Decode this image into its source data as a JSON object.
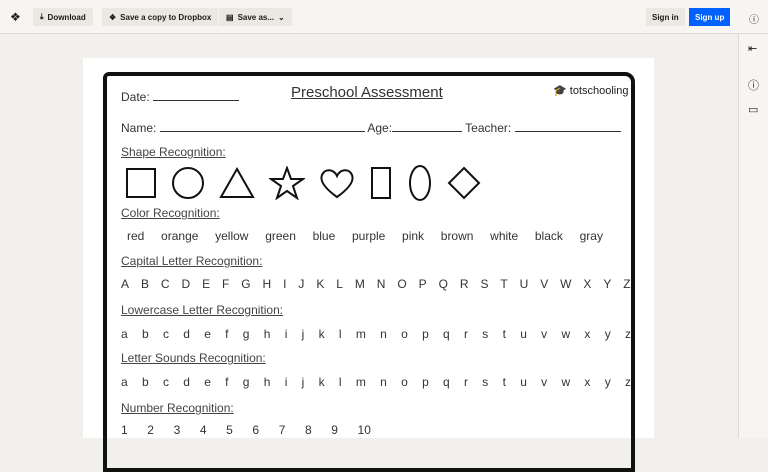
{
  "toolbar": {
    "download": "Download",
    "save_copy": "Save a copy to Dropbox",
    "save_as": "Save as...",
    "sign_in": "Sign in",
    "sign_up": "Sign up"
  },
  "doc": {
    "title": "Preschool Assessment",
    "brand": "totschooling",
    "date_label": "Date:",
    "name_label": "Name:",
    "age_label": "Age:",
    "teacher_label": "Teacher:",
    "shape_heading": "Shape Recognition:",
    "color_heading": "Color Recognition:",
    "colors": [
      "red",
      "orange",
      "yellow",
      "green",
      "blue",
      "purple",
      "pink",
      "brown",
      "white",
      "black",
      "gray"
    ],
    "capital_heading": "Capital Letter Recognition:",
    "capitals": [
      "A",
      "B",
      "C",
      "D",
      "E",
      "F",
      "G",
      "H",
      "I",
      "J",
      "K",
      "L",
      "M",
      "N",
      "O",
      "P",
      "Q",
      "R",
      "S",
      "T",
      "U",
      "V",
      "W",
      "X",
      "Y",
      "Z"
    ],
    "lower_heading": "Lowercase Letter Recognition:",
    "lowers": [
      "a",
      "b",
      "c",
      "d",
      "e",
      "f",
      "g",
      "h",
      "i",
      "j",
      "k",
      "l",
      "m",
      "n",
      "o",
      "p",
      "q",
      "r",
      "s",
      "t",
      "u",
      "v",
      "w",
      "x",
      "y",
      "z"
    ],
    "sounds_heading": "Letter Sounds Recognition:",
    "number_heading": "Number Recognition:",
    "numbers": [
      "1",
      "2",
      "3",
      "4",
      "5",
      "6",
      "7",
      "8",
      "9",
      "10"
    ]
  }
}
